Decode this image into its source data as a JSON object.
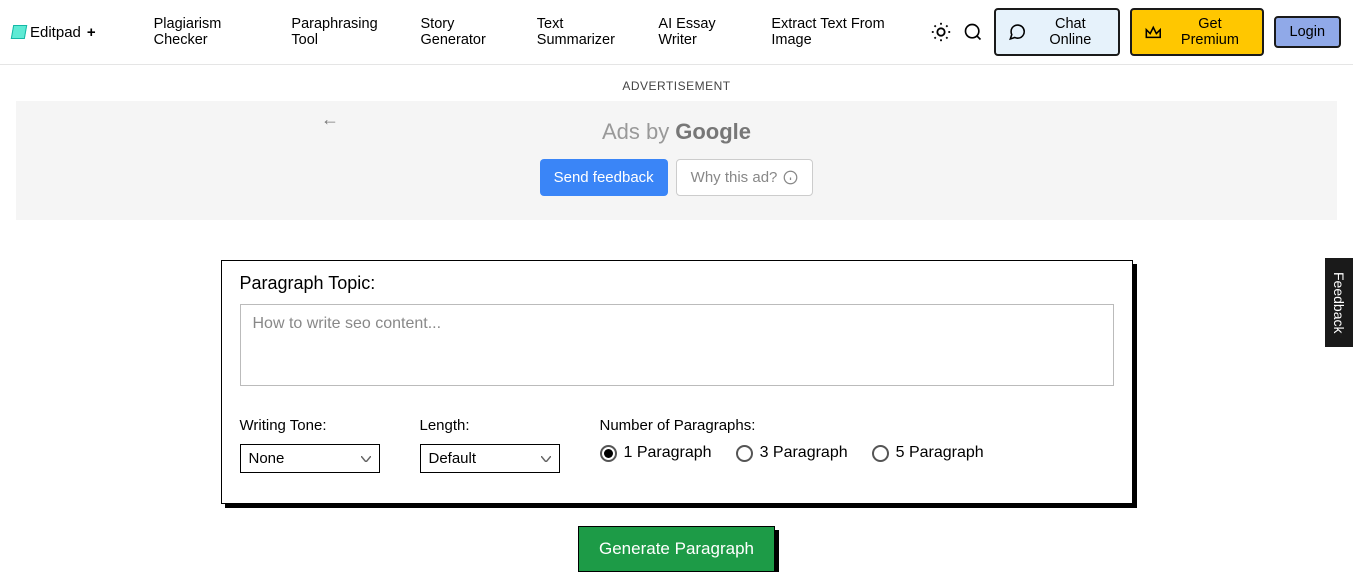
{
  "header": {
    "logo_text": "Editpad",
    "plus": "+",
    "nav": [
      "Plagiarism Checker",
      "Paraphrasing Tool",
      "Story Generator",
      "Text Summarizer",
      "AI Essay Writer",
      "Extract Text From Image"
    ],
    "chat_label": "Chat Online",
    "premium_label": "Get Premium",
    "login_label": "Login"
  },
  "ad": {
    "label": "ADVERTISEMENT",
    "ads_by_prefix": "Ads by",
    "google": "Google",
    "send_feedback": "Send feedback",
    "why_this_ad": "Why this ad?"
  },
  "form": {
    "topic_label": "Paragraph Topic:",
    "topic_placeholder": "How to write seo content...",
    "writing_tone_label": "Writing Tone:",
    "writing_tone_value": "None",
    "length_label": "Length:",
    "length_value": "Default",
    "num_paragraphs_label": "Number of Paragraphs:",
    "options": {
      "opt1": "1 Paragraph",
      "opt3": "3 Paragraph",
      "opt5": "5 Paragraph"
    },
    "selected_option": "opt1",
    "generate_label": "Generate Paragraph"
  },
  "feedback_tab": "Feedback"
}
